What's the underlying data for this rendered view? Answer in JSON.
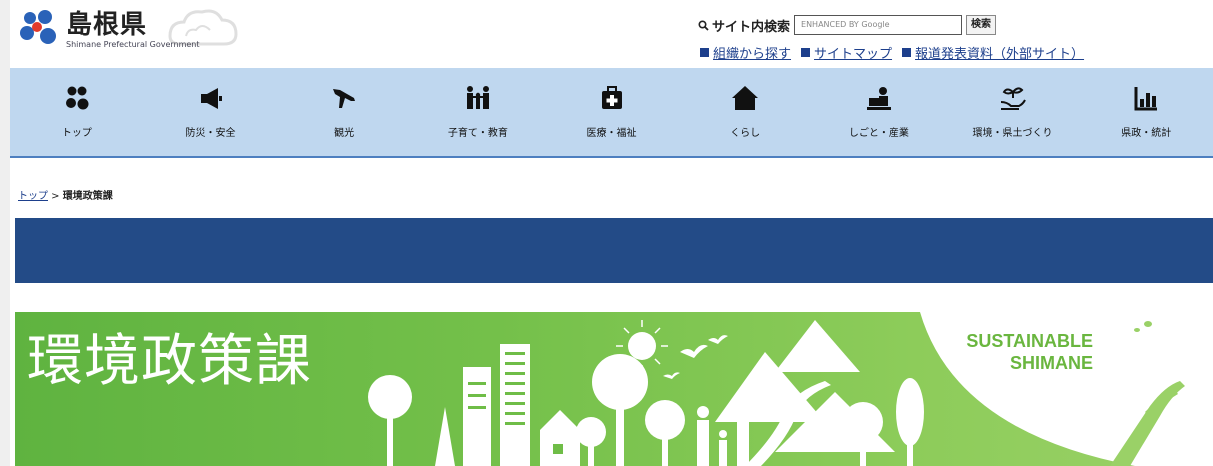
{
  "header": {
    "logo_title": "島根県",
    "logo_sub": "Shimane Prefectural Government",
    "search_label": "サイト内検索",
    "search_placeholder": "ENHANCED BY Google",
    "search_button": "検索",
    "links": [
      "組織から探す",
      "サイトマップ",
      "報道発表資料（外部サイト）"
    ]
  },
  "nav": [
    {
      "label": "トップ",
      "icon": "home-flower-icon"
    },
    {
      "label": "防災・安全",
      "icon": "megaphone-icon"
    },
    {
      "label": "観光",
      "icon": "airplane-icon"
    },
    {
      "label": "子育て・教育",
      "icon": "family-icon"
    },
    {
      "label": "医療・福祉",
      "icon": "medical-bag-icon"
    },
    {
      "label": "くらし",
      "icon": "house-icon"
    },
    {
      "label": "しごと・産業",
      "icon": "worker-icon"
    },
    {
      "label": "環境・県土づくり",
      "icon": "plant-hand-icon"
    },
    {
      "label": "県政・統計",
      "icon": "bar-chart-icon"
    }
  ],
  "breadcrumb": {
    "top": "トップ",
    "separator": " > ",
    "current": "環境政策課"
  },
  "hero": {
    "title": "環境政策課",
    "tag_line1": "SUSTAINABLE",
    "tag_line2": "SHIMANE"
  },
  "colors": {
    "nav_bg": "#bfd7ef",
    "banner_blue": "#234b87",
    "hero_green": "#74c04a",
    "link": "#1d3f8c"
  }
}
